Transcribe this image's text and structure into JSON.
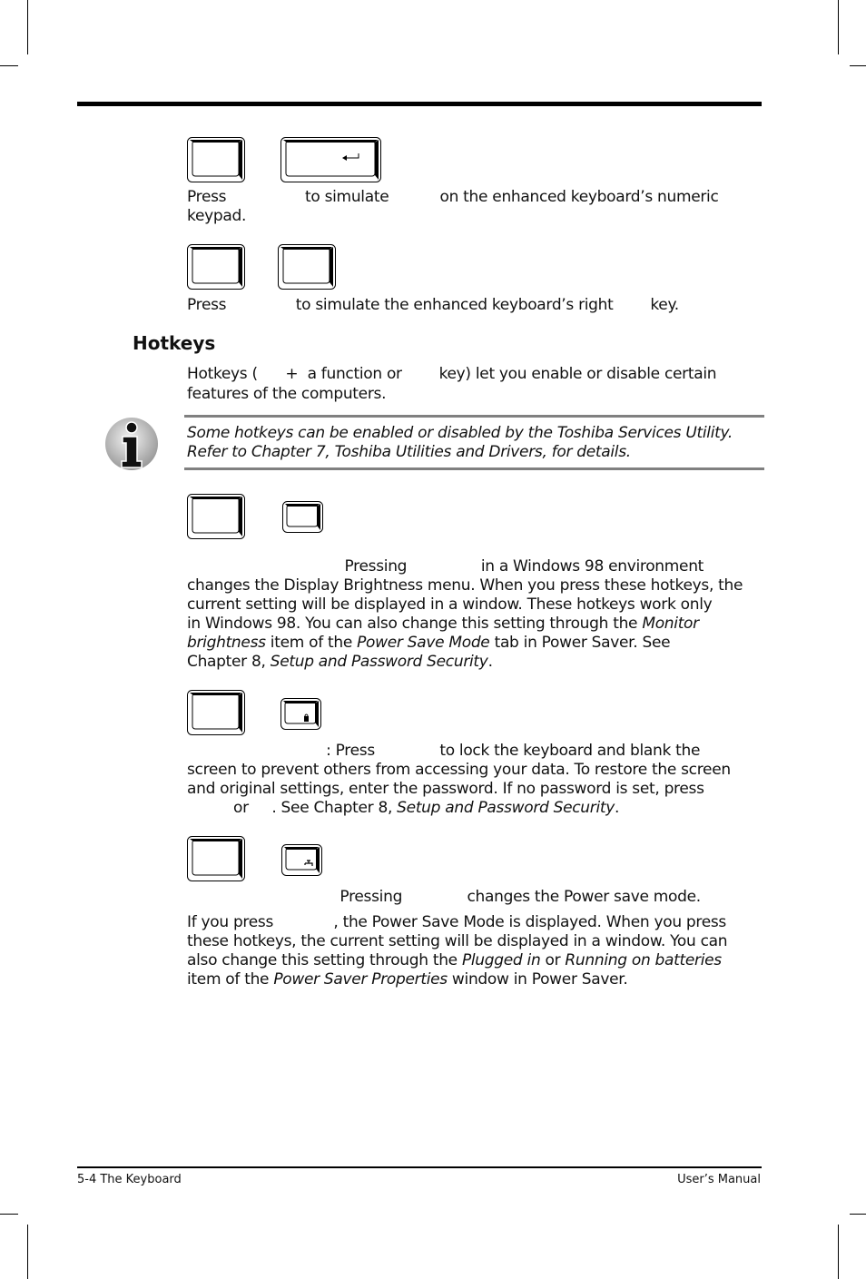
{
  "page": {
    "footer_left": "5-4  The Keyboard",
    "footer_right": "User’s Manual"
  },
  "sections": {
    "enter_key": {
      "keys": [
        "blank-key",
        "enter-key"
      ],
      "line1": "Press                 to simulate           on the enhanced keyboard’s numeric",
      "line2": "keypad."
    },
    "right_key": {
      "keys": [
        "blank-key",
        "blank-key"
      ],
      "line1": "Press               to simulate the enhanced keyboard’s right        key."
    },
    "hotkeys": {
      "heading": "Hotkeys",
      "intro_line1": "Hotkeys (      +  a function or        key) let you enable or disable certain",
      "intro_line2": "features of the computers.",
      "note": {
        "icon": "info-icon",
        "line1": "Some hotkeys can be enabled or disabled by the Toshiba Services Utility.",
        "line2": "Refer to Chapter 7, Toshiba Utilities and Drivers, for details."
      }
    },
    "brightness": {
      "keys": [
        "blank-key",
        "small-blank-key"
      ],
      "lines": [
        {
          "parts": [
            {
              "t": "                                  Pressing                in a Windows 98 environment"
            }
          ]
        },
        {
          "parts": [
            {
              "t": "changes the Display Brightness menu. When you press these hotkeys, the"
            }
          ]
        },
        {
          "parts": [
            {
              "t": "current setting will be displayed in a window. These hotkeys work only"
            }
          ]
        },
        {
          "parts": [
            {
              "t": "in Windows 98. You can also change this setting through the "
            },
            {
              "t": "Monitor",
              "i": true
            }
          ]
        },
        {
          "parts": [
            {
              "t": "brightness",
              "i": true
            },
            {
              "t": " item of the "
            },
            {
              "t": "Power Save Mode",
              "i": true
            },
            {
              "t": " tab in Power Saver. See"
            }
          ]
        },
        {
          "parts": [
            {
              "t": "Chapter 8, "
            },
            {
              "t": "Setup and Password Security",
              "i": true
            },
            {
              "t": "."
            }
          ]
        }
      ]
    },
    "lock": {
      "keys": [
        "blank-key",
        "lock-key"
      ],
      "lines": [
        {
          "parts": [
            {
              "t": "                              : Press              to lock the keyboard and blank the"
            }
          ]
        },
        {
          "parts": [
            {
              "t": "screen to prevent others from accessing your data. To restore the screen"
            }
          ]
        },
        {
          "parts": [
            {
              "t": "and original settings, enter the password. If no password is set, press"
            }
          ]
        },
        {
          "parts": [
            {
              "t": "          or     . See Chapter 8, "
            },
            {
              "t": "Setup and Password Security",
              "i": true
            },
            {
              "t": "."
            }
          ]
        }
      ]
    },
    "power_save": {
      "keys": [
        "blank-key",
        "power-save-key"
      ],
      "lines": [
        {
          "parts": [
            {
              "t": "                                 Pressing              changes the Power save mode."
            }
          ]
        }
      ],
      "para_lines": [
        {
          "parts": [
            {
              "t": "If you press             , the Power Save Mode is displayed. When you press"
            }
          ]
        },
        {
          "parts": [
            {
              "t": "these hotkeys, the current setting will be displayed in a window. You can"
            }
          ]
        },
        {
          "parts": [
            {
              "t": "also change this setting through the "
            },
            {
              "t": "Plugged in",
              "i": true
            },
            {
              "t": " or "
            },
            {
              "t": "Running on batteries",
              "i": true
            }
          ]
        },
        {
          "parts": [
            {
              "t": "item of the "
            },
            {
              "t": "Power Saver Properties",
              "i": true
            },
            {
              "t": " window in Power Saver."
            }
          ]
        }
      ]
    }
  }
}
